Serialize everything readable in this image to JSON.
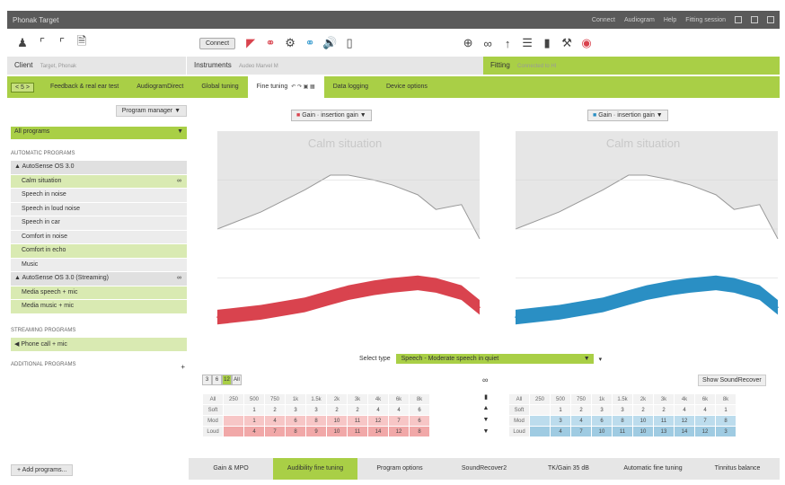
{
  "app": {
    "title": "Phonak Target"
  },
  "window_right": [
    "Connect",
    "Audiogram",
    "Help",
    "Fitting session"
  ],
  "toolbar": {
    "connect_label": "Connect",
    "icons_left": [
      "client-icon",
      "audiogram-icon",
      "audiogram2-icon",
      "document-icon"
    ],
    "icons_mid": [
      "left-ear-icon",
      "right-ear-icon",
      "gear-icon",
      "left-ear-blue-icon",
      "speaker-icon",
      "device-icon"
    ],
    "icons_right": [
      "target-icon",
      "glasses-icon",
      "pin-icon",
      "sliders-icon",
      "bars-icon",
      "wrench-icon",
      "hearing-icon"
    ]
  },
  "info": {
    "client_label": "Client",
    "client_sub": "Target, Phonak",
    "instruments_label": "Instruments",
    "instruments_sub": "Audeo Marvel M",
    "fitting_label": "Fitting",
    "fitting_sub": "Connected to HI"
  },
  "nav": {
    "arrows": "< 5 >",
    "tabs": [
      "Feedback & real ear test",
      "AudiogramDirect",
      "Global tuning",
      "Fine tuning",
      "Data logging",
      "Device options"
    ],
    "active": "Fine tuning"
  },
  "sidebar": {
    "program_manager": "Program manager",
    "all_programs": "All programs",
    "section_automatic": "AUTOMATIC PROGRAMS",
    "autosense": "AutoSense OS 3.0",
    "programs": [
      "Calm situation",
      "Speech in noise",
      "Speech in loud noise",
      "Speech in car",
      "Comfort in noise",
      "Comfort in echo",
      "Music"
    ],
    "streaming_auto": "AutoSense OS 3.0 (Streaming)",
    "streaming_items": [
      "Media speech + mic",
      "Media music + mic"
    ],
    "section_streaming": "STREAMING PROGRAMS",
    "phone_item": "Phone call + mic",
    "section_additional": "ADDITIONAL PROGRAMS",
    "add_programs": "Add programs..."
  },
  "left_panel": {
    "gain_label": "Gain · insertion gain",
    "title": "Calm situation",
    "color": "#d9434e"
  },
  "right_panel": {
    "gain_label": "Gain · insertion gain",
    "title": "Calm situation",
    "color": "#2a8fc4"
  },
  "chart_data": [
    {
      "type": "area",
      "title": "Calm situation",
      "x": [
        125,
        250,
        500,
        750,
        1000,
        1500,
        2000,
        3000,
        4000,
        6000,
        8000
      ],
      "series": [
        {
          "values": [
            4,
            6,
            9,
            12,
            14,
            16,
            17,
            18,
            17,
            14,
            8
          ]
        },
        {
          "values": [
            40,
            47,
            56,
            62,
            62,
            60,
            58,
            54,
            48,
            50,
            36
          ]
        }
      ]
    },
    {
      "type": "area",
      "title": "Calm situation",
      "x": [
        125,
        250,
        500,
        750,
        1000,
        1500,
        2000,
        3000,
        4000,
        6000,
        8000
      ],
      "series": [
        {
          "values": [
            4,
            6,
            9,
            12,
            14,
            16,
            17,
            18,
            17,
            14,
            8
          ]
        },
        {
          "values": [
            40,
            47,
            56,
            62,
            62,
            60,
            58,
            54,
            48,
            50,
            36
          ]
        }
      ]
    }
  ],
  "select_type": {
    "label": "Select type",
    "value": "Speech - Moderate speech in quiet"
  },
  "channel_buttons": [
    "3",
    "6",
    "12",
    "All"
  ],
  "show_soundrecover": "Show SoundRecover",
  "gain_table_header": [
    "All",
    "250",
    "500",
    "750",
    "1k",
    "1.5k",
    "2k",
    "3k",
    "4k",
    "6k",
    "8k"
  ],
  "gain_table_left": {
    "rows": [
      {
        "label": "Soft",
        "values": [
          "1",
          "2",
          "3",
          "3",
          "2",
          "2",
          "4",
          "4",
          "6"
        ]
      },
      {
        "label": "Mod",
        "values": [
          "1",
          "4",
          "6",
          "8",
          "10",
          "11",
          "12",
          "7",
          "6"
        ]
      },
      {
        "label": "Loud",
        "values": [
          "4",
          "7",
          "8",
          "9",
          "10",
          "11",
          "14",
          "12",
          "8"
        ]
      }
    ]
  },
  "gain_table_right": {
    "rows": [
      {
        "label": "Soft",
        "values": [
          "1",
          "2",
          "3",
          "3",
          "2",
          "2",
          "4",
          "4",
          "1"
        ]
      },
      {
        "label": "Mod",
        "values": [
          "3",
          "4",
          "6",
          "8",
          "10",
          "11",
          "12",
          "7",
          "8"
        ]
      },
      {
        "label": "Loud",
        "values": [
          "4",
          "7",
          "10",
          "11",
          "10",
          "13",
          "14",
          "12",
          "3"
        ]
      }
    ]
  },
  "bottom_tabs": [
    "Gain & MPO",
    "Audibility fine tuning",
    "Program options",
    "SoundRecover2",
    "TK/Gain 35 dB",
    "Automatic fine tuning",
    "Tinnitus balance"
  ],
  "bottom_active": "Audibility fine tuning"
}
